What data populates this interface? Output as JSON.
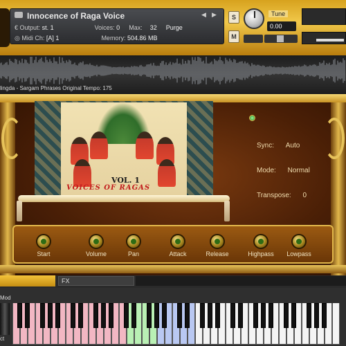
{
  "header": {
    "instrument_title": "Innocence of Raga Voice",
    "output_label": "Output:",
    "output_value": "st. 1",
    "voices_label": "Voices:",
    "voices_value": "0",
    "max_label": "Max:",
    "max_value": "32",
    "purge_label": "Purge",
    "midi_label": "Midi Ch:",
    "midi_value": "[A]  1",
    "memory_label": "Memory:",
    "memory_value": "504.86 MB",
    "s_button": "S",
    "m_button": "M",
    "tune_label": "Tune",
    "tune_value": "0.00"
  },
  "waveform": {
    "caption": "lingda - Sargam Phrases   Original Tempo: 175"
  },
  "artwork": {
    "vol_label": "VOL. 1",
    "voices_label": "VOICES OF RAGAS"
  },
  "params": {
    "sync_label": "Sync:",
    "sync_value": "Auto",
    "mode_label": "Mode:",
    "mode_value": "Normal",
    "transpose_label": "Transpose:",
    "transpose_value": "0"
  },
  "knobs": [
    {
      "label": "Start"
    },
    {
      "label": "Volume"
    },
    {
      "label": "Pan"
    },
    {
      "label": "Attack"
    },
    {
      "label": "Release"
    },
    {
      "label": "Highpass"
    },
    {
      "label": "Lowpass"
    }
  ],
  "tabs": {
    "fx_label": "FX"
  },
  "keyboard": {
    "mod_label": "Mod",
    "oct_label": "ct",
    "key_colors": {
      "pink": "#f2b7c3",
      "green": "#b9f0b4",
      "blue": "#b9c8f2",
      "white": "#f4f4f4"
    }
  },
  "colors": {
    "gold": "#e2b84b",
    "panel_brown": "#4a1f06",
    "text_cream": "#f0dcae"
  }
}
